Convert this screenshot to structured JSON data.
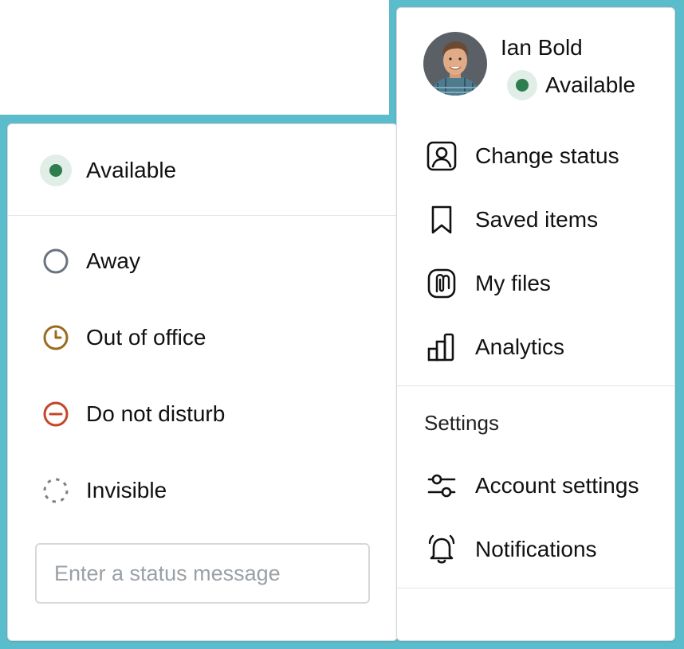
{
  "profile": {
    "name": "Ian Bold",
    "status": "Available",
    "avatar": "avatar-photo"
  },
  "profile_menu": {
    "items": [
      {
        "label": "Change status",
        "icon": "user-square-icon"
      },
      {
        "label": "Saved items",
        "icon": "bookmark-icon"
      },
      {
        "label": "My files",
        "icon": "paperclip-icon"
      },
      {
        "label": "Analytics",
        "icon": "bar-chart-icon"
      }
    ],
    "settings_section": {
      "label": "Settings",
      "items": [
        {
          "label": "Account settings",
          "icon": "sliders-icon"
        },
        {
          "label": "Notifications",
          "icon": "bell-icon"
        }
      ]
    }
  },
  "status_menu": {
    "current": {
      "label": "Available",
      "icon": "available-dot-icon",
      "color": "#2e7d4f"
    },
    "options": [
      {
        "label": "Away",
        "icon": "away-circle-icon",
        "color": "#6b7380"
      },
      {
        "label": "Out of office",
        "icon": "clock-icon",
        "color": "#9a6b1f"
      },
      {
        "label": "Do not disturb",
        "icon": "minus-circle-icon",
        "color": "#c4452a"
      },
      {
        "label": "Invisible",
        "icon": "dashed-circle-icon",
        "color": "#7a808a"
      }
    ],
    "message_input": {
      "placeholder": "Enter a status message",
      "value": ""
    }
  },
  "colors": {
    "background_accent": "#5bbccc",
    "available": "#2e7d4f",
    "available_bg": "#e1eee7"
  }
}
